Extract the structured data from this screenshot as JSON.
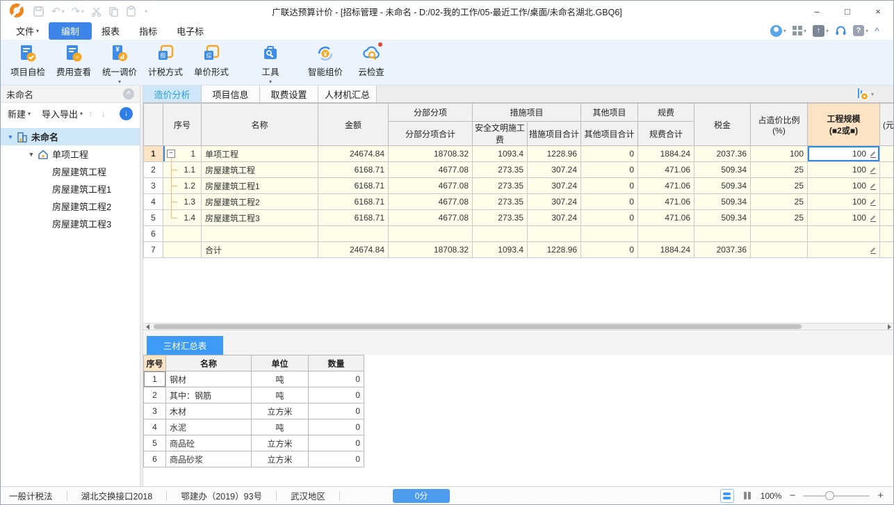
{
  "window": {
    "title": "广联达预算计价 - [招标管理 - 未命名 - D:/02-我的工作/05-最近工作/桌面/未命名湖北.GBQ6]"
  },
  "glyphs": {
    "dropdown": "▾",
    "more": "▾",
    "minimize": "–",
    "maximize": "□",
    "close": "×",
    "undo": "↶",
    "redo": "↷",
    "up_arrow": "↑",
    "down_arrow": "↓",
    "chevron_up": "^",
    "tree_minus": "−",
    "expander": "▼",
    "minus": "−",
    "plus": "+",
    "question": "?"
  },
  "menu": {
    "items": [
      {
        "label": "文件",
        "dropdown": true
      },
      {
        "label": "编制",
        "active": true
      },
      {
        "label": "报表"
      },
      {
        "label": "指标"
      },
      {
        "label": "电子标"
      }
    ]
  },
  "ribbon": {
    "buttons": [
      {
        "label": "项目自检"
      },
      {
        "label": "费用查看"
      },
      {
        "label": "统一调价",
        "dropdown": true
      },
      {
        "label": "计税方式"
      },
      {
        "label": "单价形式"
      },
      {
        "label": "工具",
        "dropdown": true
      },
      {
        "label": "智能组价"
      },
      {
        "label": "云检查",
        "notification": true
      }
    ]
  },
  "sidebar": {
    "header": "未命名",
    "toolbar": {
      "new_label": "新建",
      "import_export_label": "导入导出"
    },
    "tree": [
      {
        "label": "未命名",
        "level": 0,
        "selected": true,
        "icon": "building"
      },
      {
        "label": "单项工程",
        "level": 1,
        "icon": "house"
      },
      {
        "label": "房屋建筑工程",
        "level": 2
      },
      {
        "label": "房屋建筑工程1",
        "level": 2
      },
      {
        "label": "房屋建筑工程2",
        "level": 2
      },
      {
        "label": "房屋建筑工程3",
        "level": 2
      }
    ]
  },
  "tabs": {
    "items": [
      {
        "label": "造价分析",
        "active": true
      },
      {
        "label": "项目信息"
      },
      {
        "label": "取费设置"
      },
      {
        "label": "人材机汇总"
      }
    ]
  },
  "grid": {
    "headers": {
      "seq": "序号",
      "name": "名称",
      "amount": "金额",
      "fbfx_group": "分部分项",
      "fbfx_sub": "分部分项合计",
      "cs_group": "措施项目",
      "cs_sub1": "安全文明施工费",
      "cs_sub2": "措施项目合计",
      "qt_group": "其他项目",
      "qt_sub": "其他项目合计",
      "gf_group": "规费",
      "gf_sub": "规费合计",
      "tax": "税金",
      "ratio_line1": "占造价比例",
      "ratio_line2": "(%)",
      "scale_line1": "工程规模",
      "scale_line2": "(■2或■)",
      "partial": "(元"
    },
    "rows": [
      {
        "num": "1",
        "seq": "1",
        "name": "单项工程",
        "amount": "24674.84",
        "fbfx": "18708.32",
        "aqwm": "1093.4",
        "cs": "1228.96",
        "qt": "0",
        "gf": "1884.24",
        "tax": "2037.36",
        "ratio": "100",
        "scale": "100"
      },
      {
        "num": "2",
        "seq": "1.1",
        "name": "房屋建筑工程",
        "amount": "6168.71",
        "fbfx": "4677.08",
        "aqwm": "273.35",
        "cs": "307.24",
        "qt": "0",
        "gf": "471.06",
        "tax": "509.34",
        "ratio": "25",
        "scale": "100"
      },
      {
        "num": "3",
        "seq": "1.2",
        "name": "房屋建筑工程1",
        "amount": "6168.71",
        "fbfx": "4677.08",
        "aqwm": "273.35",
        "cs": "307.24",
        "qt": "0",
        "gf": "471.06",
        "tax": "509.34",
        "ratio": "25",
        "scale": "100"
      },
      {
        "num": "4",
        "seq": "1.3",
        "name": "房屋建筑工程2",
        "amount": "6168.71",
        "fbfx": "4677.08",
        "aqwm": "273.35",
        "cs": "307.24",
        "qt": "0",
        "gf": "471.06",
        "tax": "509.34",
        "ratio": "25",
        "scale": "100"
      },
      {
        "num": "5",
        "seq": "1.4",
        "name": "房屋建筑工程3",
        "amount": "6168.71",
        "fbfx": "4677.08",
        "aqwm": "273.35",
        "cs": "307.24",
        "qt": "0",
        "gf": "471.06",
        "tax": "509.34",
        "ratio": "25",
        "scale": "100"
      },
      {
        "num": "6",
        "seq": "",
        "name": "",
        "amount": "",
        "fbfx": "",
        "aqwm": "",
        "cs": "",
        "qt": "",
        "gf": "",
        "tax": "",
        "ratio": "",
        "scale": ""
      },
      {
        "num": "7",
        "seq": "",
        "name": "合计",
        "amount": "24674.84",
        "fbfx": "18708.32",
        "aqwm": "1093.4",
        "cs": "1228.96",
        "qt": "0",
        "gf": "1884.24",
        "tax": "2037.36",
        "ratio": "",
        "scale": ""
      }
    ]
  },
  "bottom": {
    "tab": "三材汇总表",
    "headers": [
      "序号",
      "名称",
      "单位",
      "数量"
    ],
    "rows": [
      [
        "1",
        "钢材",
        "吨",
        "0"
      ],
      [
        "2",
        "其中：钢筋",
        "吨",
        "0"
      ],
      [
        "3",
        "木材",
        "立方米",
        "0"
      ],
      [
        "4",
        "水泥",
        "吨",
        "0"
      ],
      [
        "5",
        "商品砼",
        "立方米",
        "0"
      ],
      [
        "6",
        "商品砂浆",
        "立方米",
        "0"
      ]
    ]
  },
  "status": {
    "items": [
      "一般计税法",
      "湖北交换接口2018",
      "鄂建办（2019）93号",
      "武汉地区"
    ],
    "score": "0分",
    "zoom": "100%"
  },
  "colors": {
    "accent_blue": "#3d85e8",
    "bright_blue": "#3e9bf5",
    "tab_active_bg": "#cde7f9",
    "grid_cream": "#fdfde9",
    "peach": "#fbe3c3",
    "tree_line_orange": "#f3b96f",
    "logo_orange": "#f08519"
  }
}
